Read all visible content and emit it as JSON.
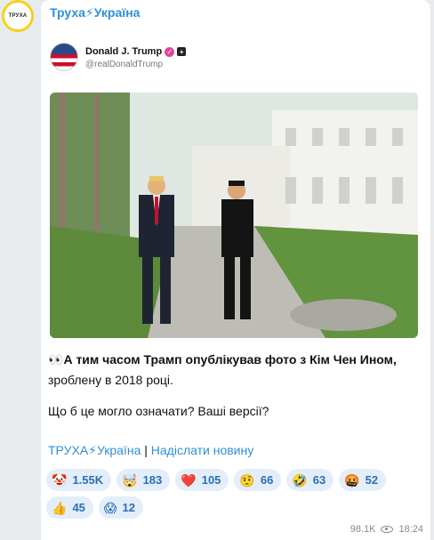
{
  "channel": {
    "avatar_text": "ТРУХА",
    "name": "Труха⚡Україна"
  },
  "tweet": {
    "name": "Donald J. Trump",
    "handle": "@realDonaldTrump"
  },
  "post": {
    "line1_emoji": "👀",
    "line1_bold": "А тим часом Трамп опублікував фото з Кім Чен Ином,",
    "line2": "зроблену в 2018 році.",
    "line3": "Що б це могло означати? Ваші версії?"
  },
  "links": {
    "channel": "ТРУХА⚡Україна",
    "separator": " | ",
    "send": "Надіслати новину"
  },
  "reactions": [
    {
      "emoji": "🤡",
      "count": "1.55K"
    },
    {
      "emoji": "🤯",
      "count": "183"
    },
    {
      "emoji": "❤️",
      "count": "105"
    },
    {
      "emoji": "🤨",
      "count": "66"
    },
    {
      "emoji": "🤣",
      "count": "63"
    },
    {
      "emoji": "🤬",
      "count": "52"
    },
    {
      "emoji": "👍",
      "count": "45"
    },
    {
      "emoji": "😱",
      "count": "12"
    }
  ],
  "meta": {
    "views": "98.1K",
    "views_icon": "eye-icon",
    "time": "18:24"
  }
}
